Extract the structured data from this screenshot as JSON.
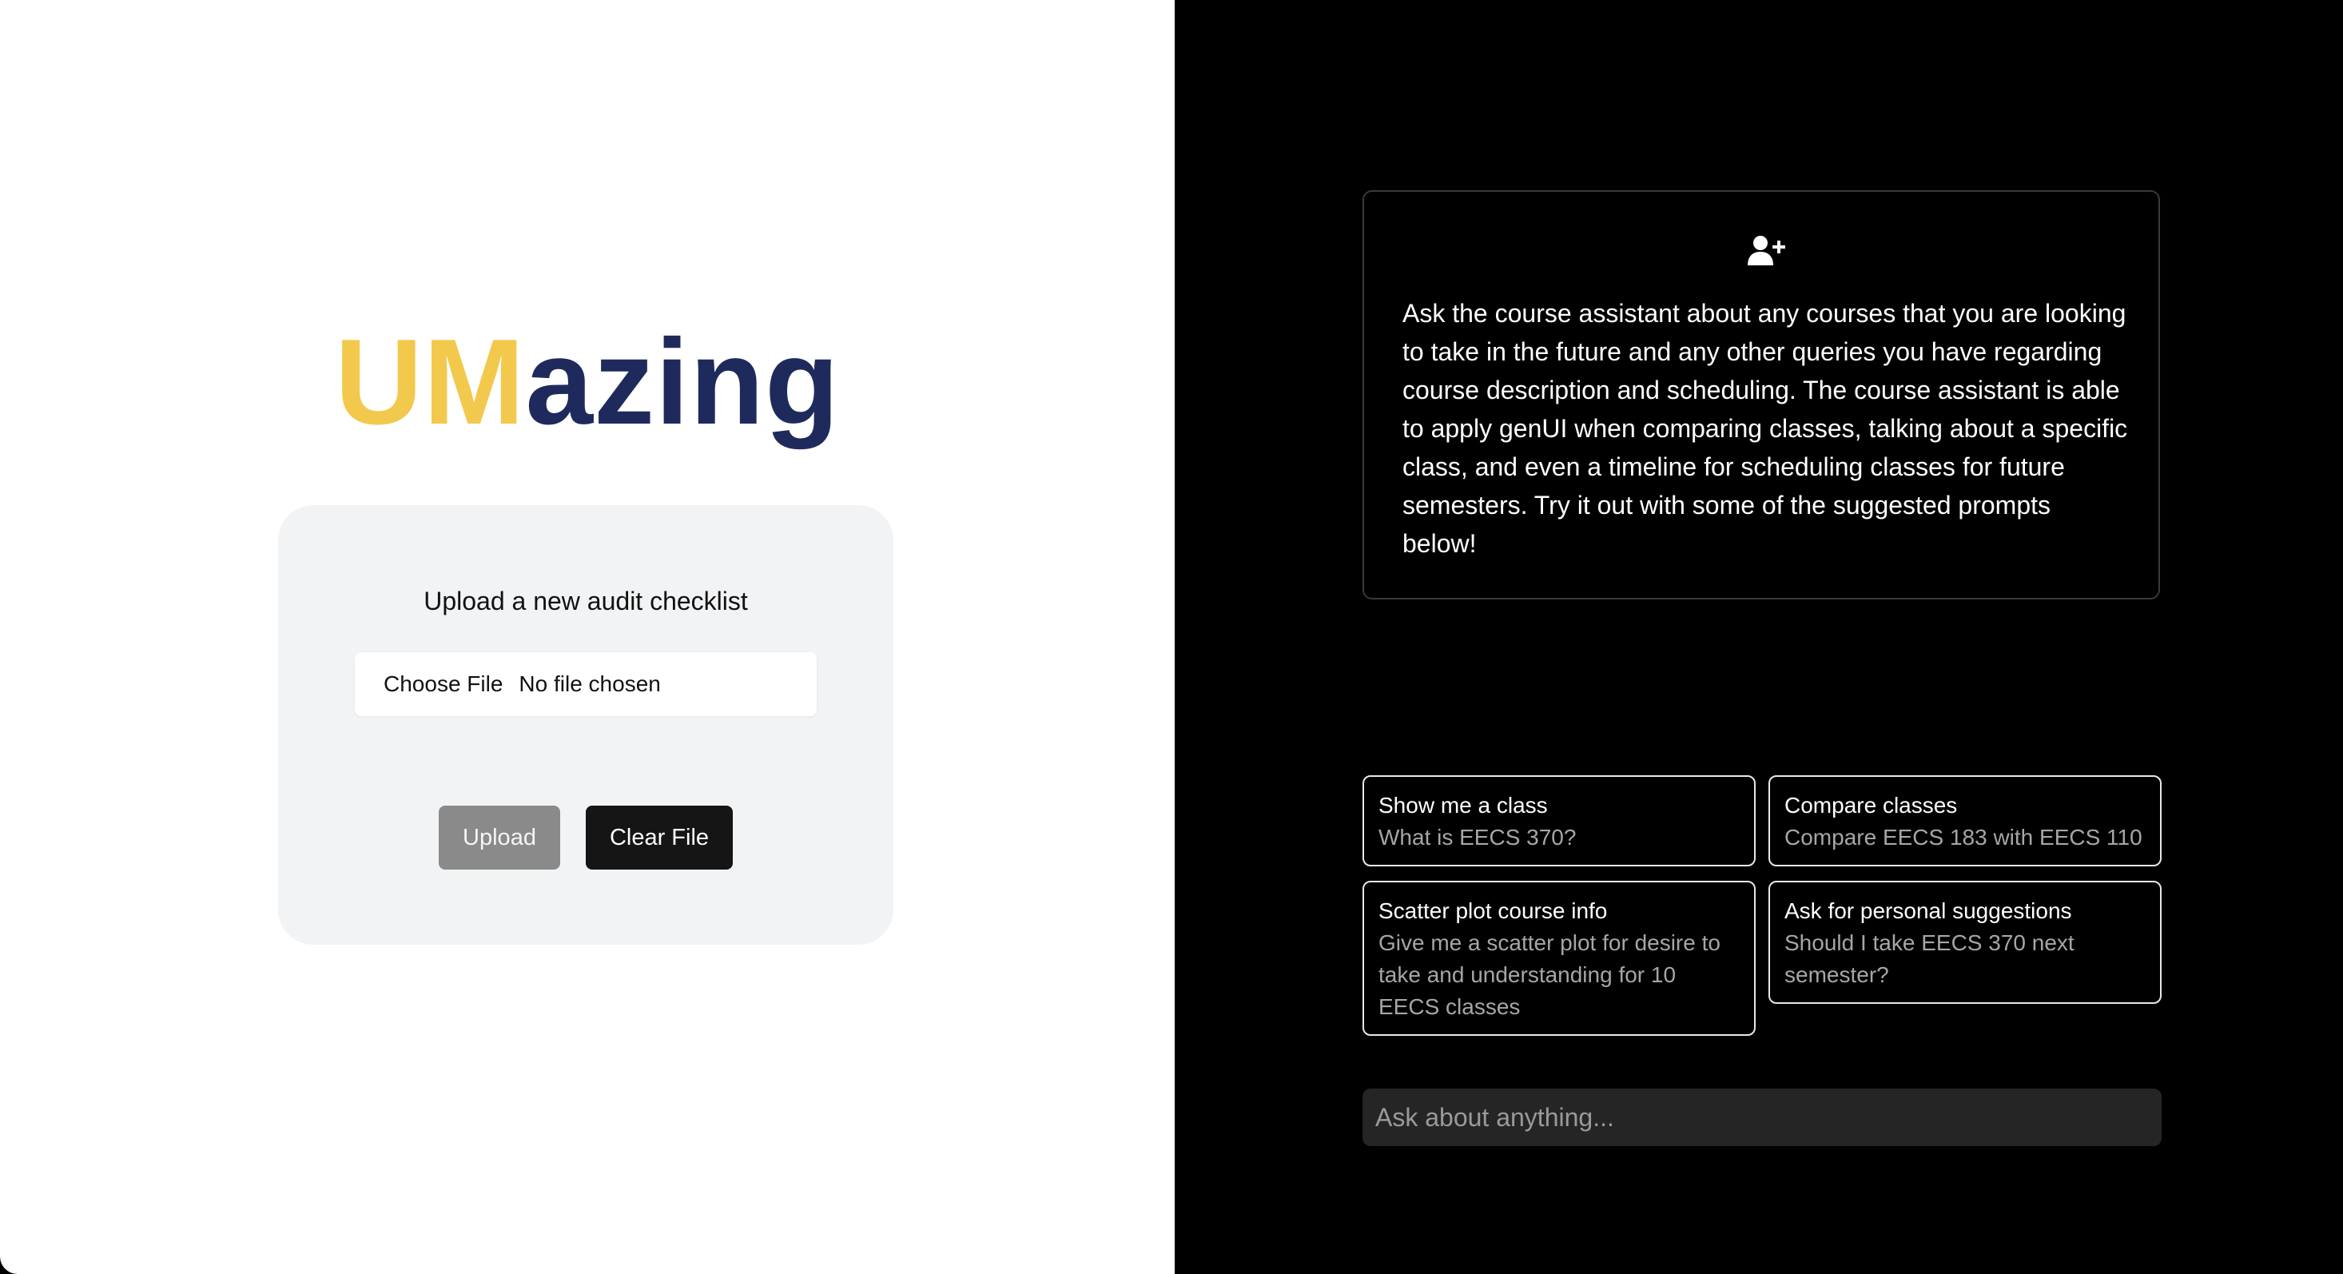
{
  "logo": {
    "part1": "UM",
    "part2": "azing",
    "part1_color": "#f2c94c",
    "part2_color": "#1f2a5c"
  },
  "upload_panel": {
    "title": "Upload a new audit checklist",
    "choose_file_label": "Choose File",
    "file_status": "No file chosen",
    "upload_button": "Upload",
    "clear_button": "Clear File"
  },
  "assistant_info": {
    "icon": "user-plus-icon",
    "text": "Ask the course assistant about any courses that you are looking to take in the future and any other queries you have regarding course description and scheduling. The course assistant is able to apply genUI when comparing classes, talking about a specific class, and even a timeline for scheduling classes for future semesters. Try it out with some of the suggested prompts below!"
  },
  "suggestions": [
    {
      "title": "Show me a class",
      "prompt": "What is EECS 370?"
    },
    {
      "title": "Compare classes",
      "prompt": "Compare EECS 183 with EECS 110"
    },
    {
      "title": "Scatter plot course info",
      "prompt": "Give me a scatter plot for desire to take and understanding for 10 EECS classes"
    },
    {
      "title": "Ask for personal suggestions",
      "prompt": "Should I take EECS 370 next semester?"
    }
  ],
  "chat": {
    "placeholder": "Ask about anything...",
    "value": ""
  }
}
